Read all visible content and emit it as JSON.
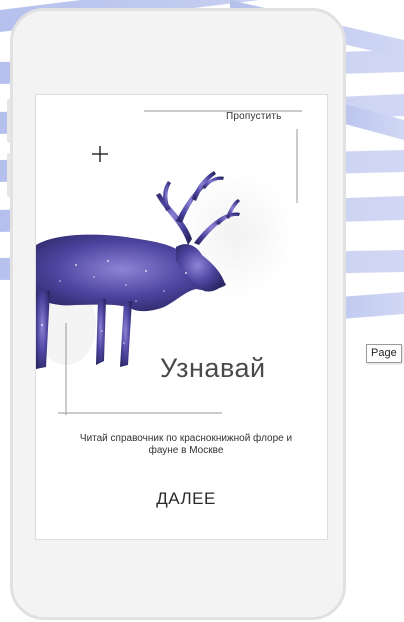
{
  "onboarding": {
    "skip_label": "Пропустить",
    "headline": "Узнавай",
    "description": "Читай справочник по краснокнижной флоре и фауне в Москве",
    "next_label": "ДАЛЕЕ"
  },
  "tooltip": {
    "label": "Page"
  },
  "colors": {
    "stripe": "#b9c3ee",
    "deer_dark": "#2d2a6a",
    "deer_light": "#7e73c8",
    "phone_frame": "#e1e1e1"
  },
  "icons": {
    "plus": "plus-icon",
    "illustration": "reindeer-illustration"
  }
}
